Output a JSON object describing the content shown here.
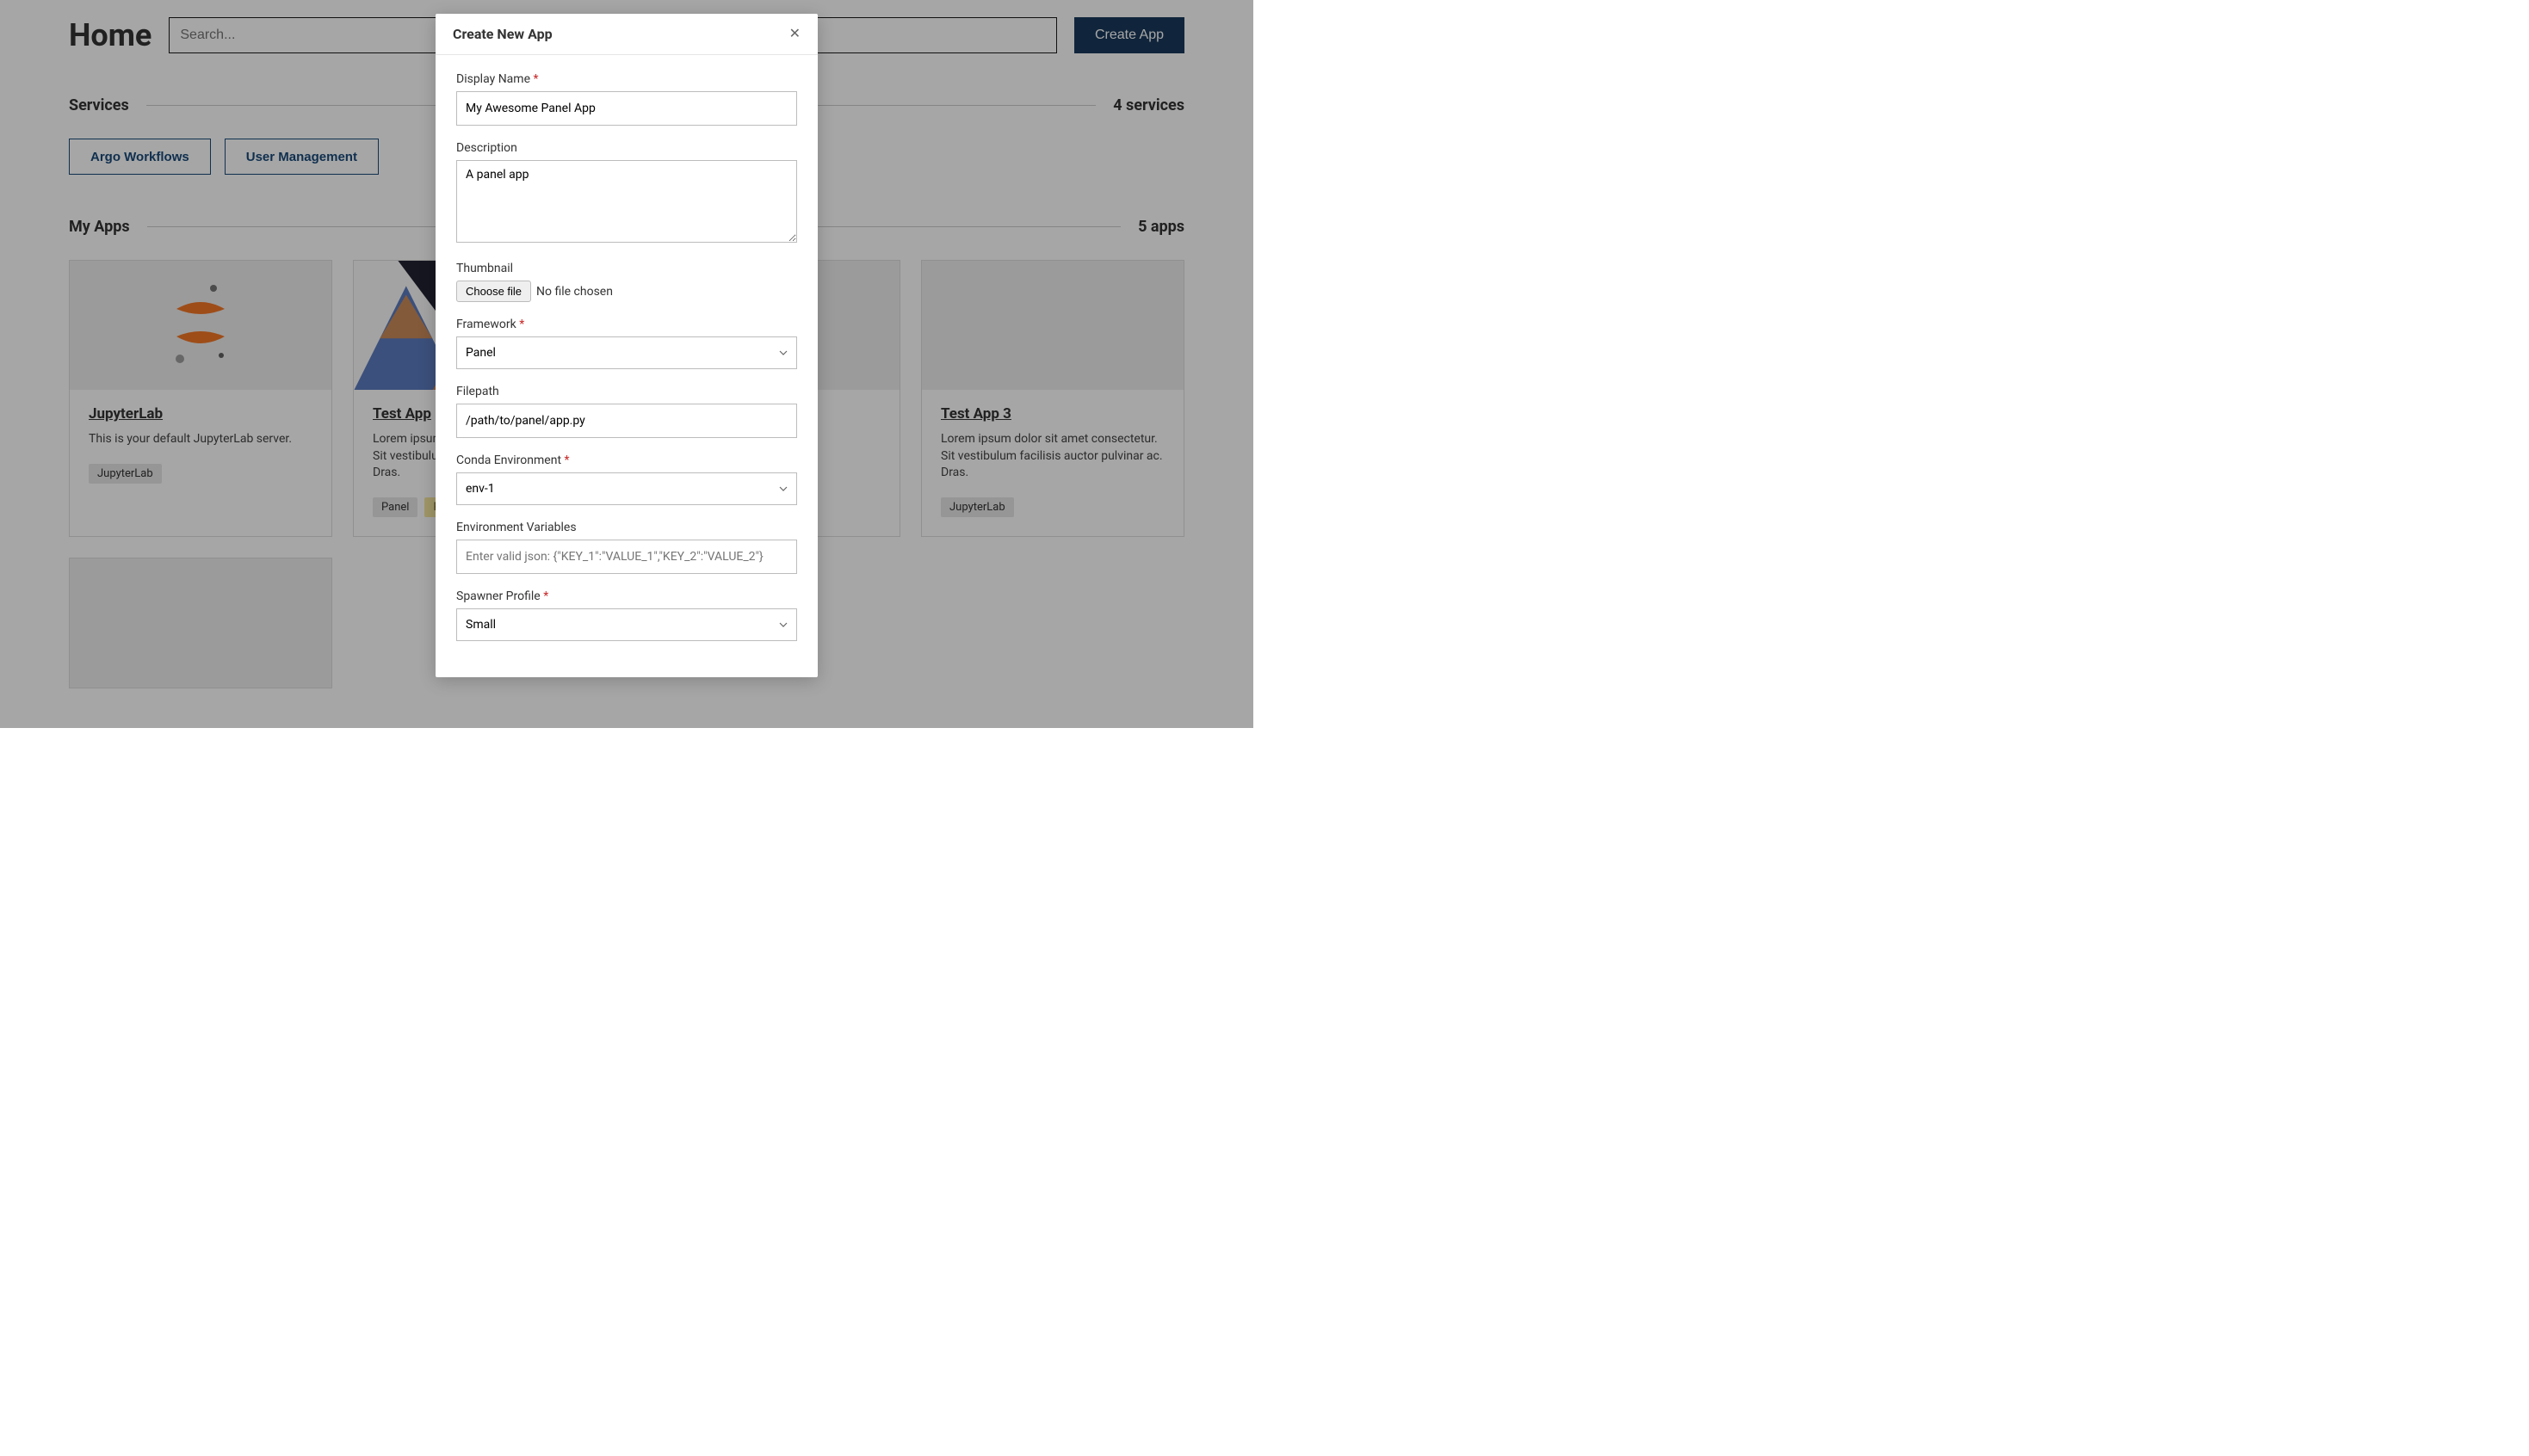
{
  "header": {
    "title": "Home",
    "search_placeholder": "Search...",
    "create_app_label": "Create App"
  },
  "services_section": {
    "heading": "Services",
    "count_label": "4 services",
    "items": [
      {
        "label": "Argo Workflows"
      },
      {
        "label": "User Management"
      }
    ]
  },
  "apps_section": {
    "heading": "My Apps",
    "count_label": "5 apps",
    "cards": [
      {
        "title": "JupyterLab",
        "desc": "This is your default JupyterLab server.",
        "tags": [
          {
            "text": "JupyterLab",
            "variant": "gray"
          }
        ],
        "thumb": "jupyter"
      },
      {
        "title": "Test App",
        "desc": "Lorem ipsum dolor sit amet consectetur. Sit vestibulum facilisis auctor pulvinar ac. Dras.",
        "tags": [
          {
            "text": "Panel",
            "variant": "gray"
          },
          {
            "text": "Public",
            "variant": "yellow"
          }
        ],
        "thumb": "triangles"
      },
      {
        "title": "",
        "desc": "",
        "tags": [],
        "thumb": "blank"
      },
      {
        "title": "Test App 3",
        "desc": "Lorem ipsum dolor sit amet consectetur. Sit vestibulum facilisis auctor pulvinar ac. Dras.",
        "tags": [
          {
            "text": "JupyterLab",
            "variant": "gray"
          }
        ],
        "thumb": "blank"
      }
    ]
  },
  "modal": {
    "title": "Create New App",
    "display_name_label": "Display Name",
    "display_name_value": "My Awesome Panel App",
    "description_label": "Description",
    "description_value": "A panel app",
    "thumbnail_label": "Thumbnail",
    "choose_file_label": "Choose file",
    "file_status": "No file chosen",
    "framework_label": "Framework",
    "framework_value": "Panel",
    "filepath_label": "Filepath",
    "filepath_value": "/path/to/panel/app.py",
    "conda_env_label": "Conda Environment",
    "conda_env_value": "env-1",
    "env_vars_label": "Environment Variables",
    "env_vars_placeholder": "Enter valid json: {\"KEY_1\":\"VALUE_1\",\"KEY_2\":\"VALUE_2\"}",
    "spawner_label": "Spawner Profile",
    "spawner_value": "Small"
  }
}
